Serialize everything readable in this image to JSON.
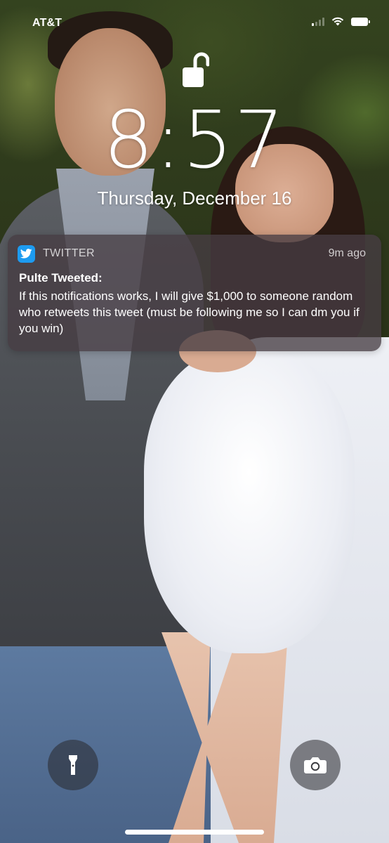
{
  "status_bar": {
    "carrier": "AT&T",
    "icons": [
      "signal-icon",
      "wifi-icon",
      "battery-icon"
    ]
  },
  "lock_screen": {
    "lock_icon": "unlocked-padlock-icon",
    "time": "8:57",
    "date": "Thursday, December 16"
  },
  "notification": {
    "app_icon": "twitter-bird-icon",
    "app_name": "TWITTER",
    "time_ago": "9m ago",
    "title": "Pulte Tweeted:",
    "body": "If this notifications works, I will give $1,000 to someone random who retweets this tweet (must be following me so I can dm you if you win)",
    "accent_color": "#1d9bf0"
  },
  "controls": {
    "left_icon": "flashlight-icon",
    "right_icon": "camera-icon"
  }
}
